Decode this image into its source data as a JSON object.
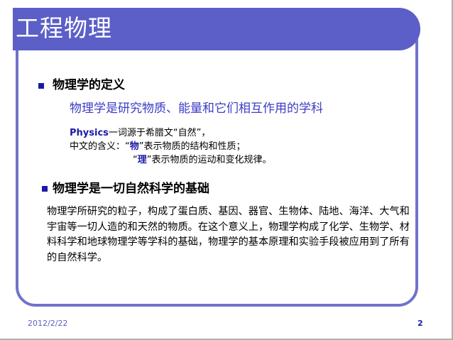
{
  "slide": {
    "title": "工程物理",
    "section1": {
      "heading": "物理学的定义",
      "definition": "物理学是研究物质、能量和它们相互作用的学科",
      "line1_em": "Physics",
      "line1_rest": "一词源于希腊文“自然”，",
      "line2_prefix": "中文的含义：“",
      "line2_em": "物",
      "line2_rest": "”表示物质的结构和性质；",
      "line3_prefix": "“",
      "line3_em": "理",
      "line3_rest": "”表示物质的运动和变化规律。"
    },
    "section2": {
      "heading": "物理学是一切自然科学的基础",
      "body": "物理学所研究的粒子，构成了蛋白质、基因、器官、生物体、陆地、海洋、大气和宇宙等一切人造的和天然的物质。在这个意义上，物理学构成了化学、生物学、材料科学和地球物理学等学科的基础，物理学的基本原理和实验手段被应用到了所有的自然科学。"
    },
    "footer": {
      "date": "2012/2/22",
      "page": "2"
    }
  },
  "colors": {
    "title_bar": "#5b5fc7",
    "frame": "#7073c9",
    "definition_text": "#3c3cc4",
    "emphasis": "#1a1aa8"
  }
}
